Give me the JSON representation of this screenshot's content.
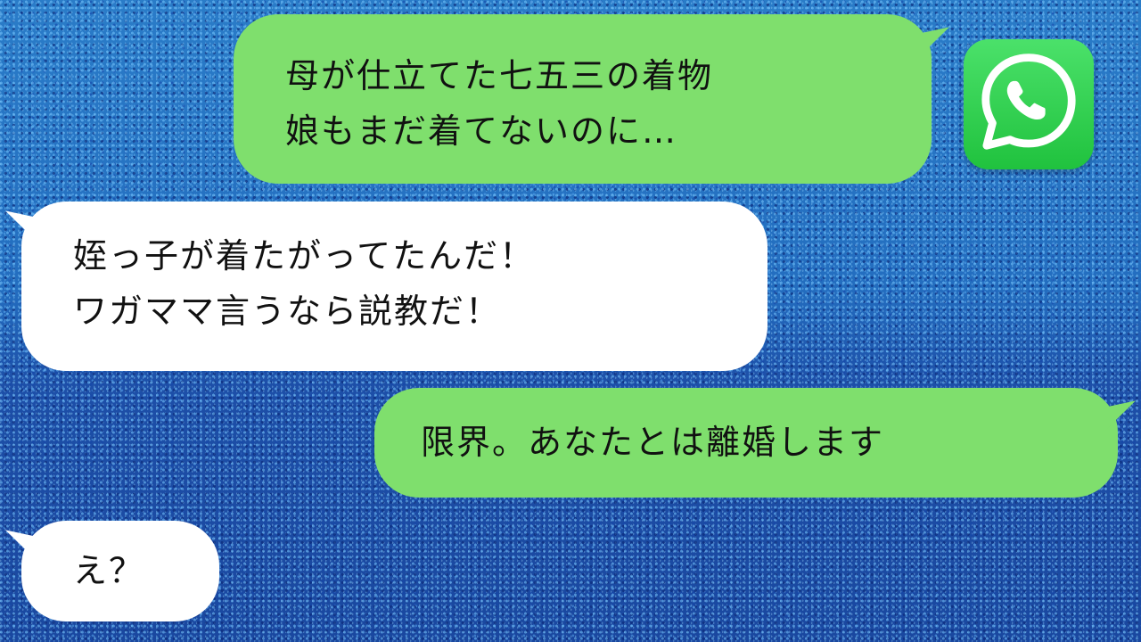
{
  "colors": {
    "sent_bubble": "#7fdf6d",
    "received_bubble": "#ffffff",
    "background": "#1f5fb3",
    "whatsapp_icon": "#25d366"
  },
  "app_icon": "whatsapp-icon",
  "messages": [
    {
      "sender": "self",
      "lines": [
        "母が仕立てた七五三の着物",
        "娘もまだ着てないのに…"
      ]
    },
    {
      "sender": "other",
      "lines": [
        "姪っ子が着たがってたんだ！",
        "ワガママ言うなら説教だ！"
      ]
    },
    {
      "sender": "self",
      "lines": [
        "限界。あなたとは離婚します"
      ]
    },
    {
      "sender": "other",
      "lines": [
        "え？"
      ]
    }
  ]
}
